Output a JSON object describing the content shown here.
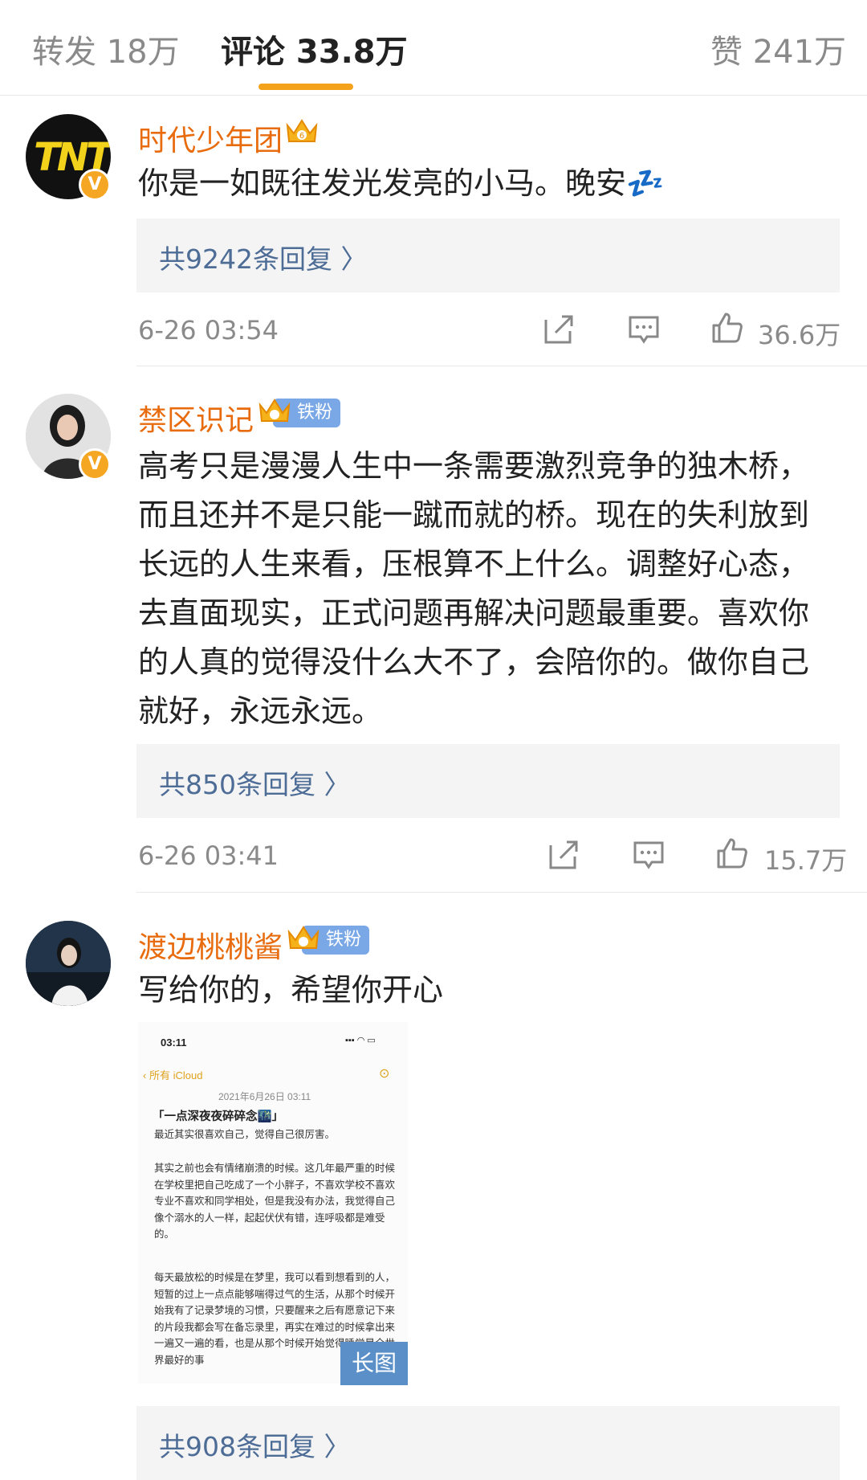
{
  "tabs": {
    "repost": "转发 18万",
    "comments": "评论 33.8万",
    "likes": "赞 241万"
  },
  "colors": {
    "accent": "#f4a21c",
    "username": "#e86b0e",
    "link": "#4d6c96",
    "badge": "#7aa8e6"
  },
  "comments": [
    {
      "username": "时代少年团",
      "text": "你是一如既往发光发亮的小马。晚安💤",
      "replies": "共9242条回复 〉",
      "time": "6-26 03:54",
      "likes": "36.6万",
      "avatar_logo": "TNT"
    },
    {
      "username": "禁区识记",
      "badge": "铁粉",
      "text": "高考只是漫漫人生中一条需要激烈竞争的独木桥，而且还并不是只能一蹴而就的桥。现在的失利放到长远的人生来看，压根算不上什么。调整好心态，去直面现实，正式问题再解决问题最重要。喜欢你的人真的觉得没什么大不了，会陪你的。做你自己就好，永远永远。",
      "replies": "共850条回复 〉",
      "time": "6-26 03:41",
      "likes": "15.7万"
    },
    {
      "username": "渡边桃桃酱",
      "badge": "铁粉",
      "text": "写给你的，希望你开心",
      "replies": "共908条回复 〉",
      "long_image_tag": "长图",
      "screenshot": {
        "time": "03:11",
        "back": "所有 iCloud",
        "date": "2021年6月26日 03:11",
        "title": "「一点深夜夜碎碎念🌃」",
        "lines": [
          "最近其实很喜欢自己，觉得自己很厉害。",
          "其实之前也会有情绪崩溃的时候。这几年最严重的时候在学校里把自己吃成了一个小胖子，不喜欢学校不喜欢专业不喜欢和同学相处，但是我没有办法，我觉得自己像个溺水的人一样，起起伏伏有错，连呼吸都是难受的。",
          "每天最放松的时候是在梦里，我可以看到想看到的人，短暂的过上一点点能够喘得过气的生活，从那个时候开始我有了记录梦境的习惯，只要醒来之后有愿意记下来的片段我都会写在备忘录里，再实在难过的时候拿出来一遍又一遍的看，也是从那个时候开始觉得睡觉是全世界最好的事"
        ]
      }
    }
  ]
}
